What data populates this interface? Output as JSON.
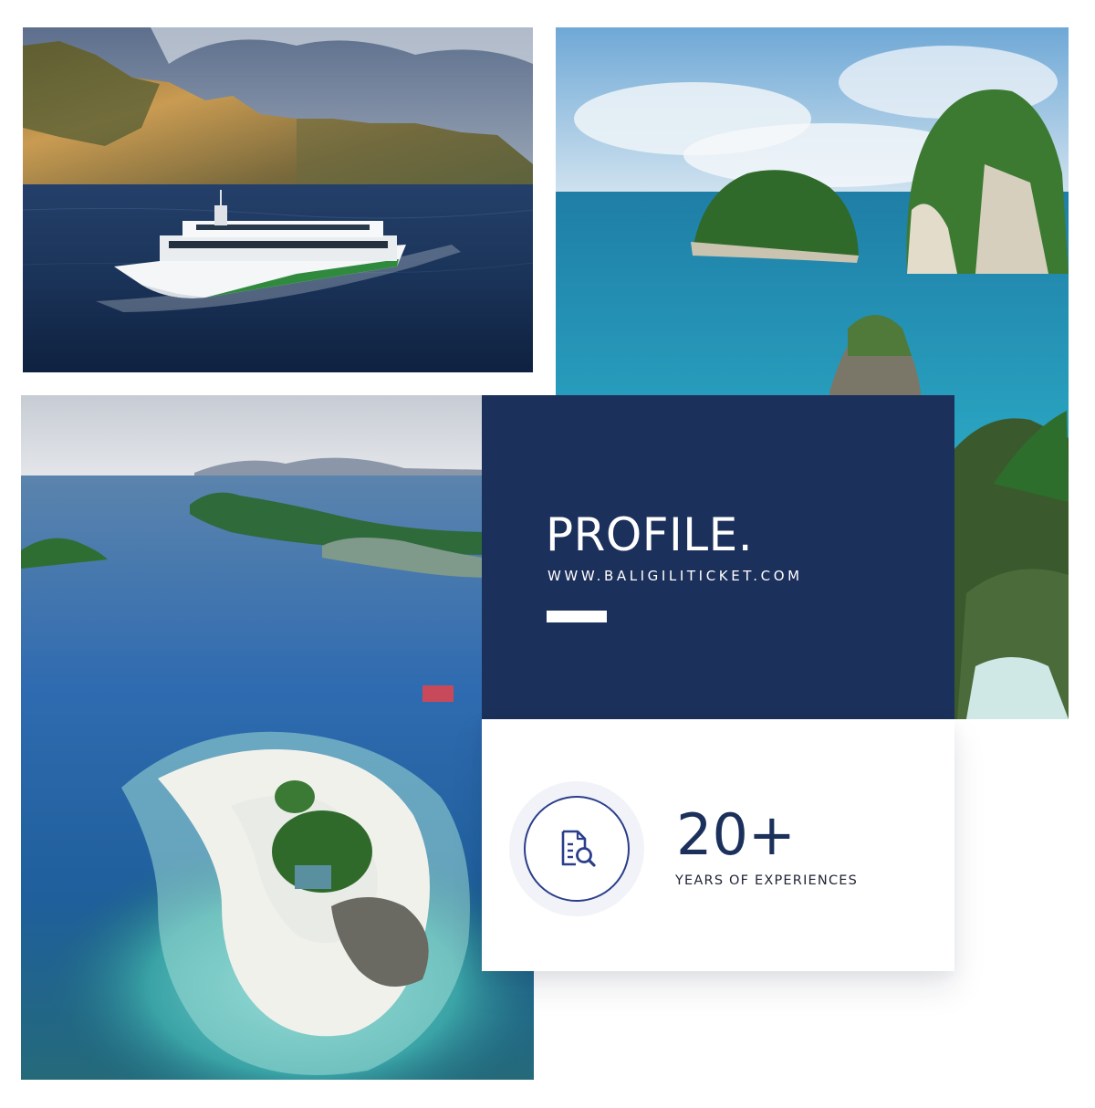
{
  "profile": {
    "title": "PROFILE.",
    "website": "WWW.BALIGILITICKET.COM"
  },
  "stats": {
    "value": "20+",
    "label": "YEARS OF EXPERIENCES",
    "icon": "document-search-icon"
  },
  "colors": {
    "navy": "#1c305c",
    "accent_blue": "#2a3e8a",
    "white": "#ffffff"
  }
}
